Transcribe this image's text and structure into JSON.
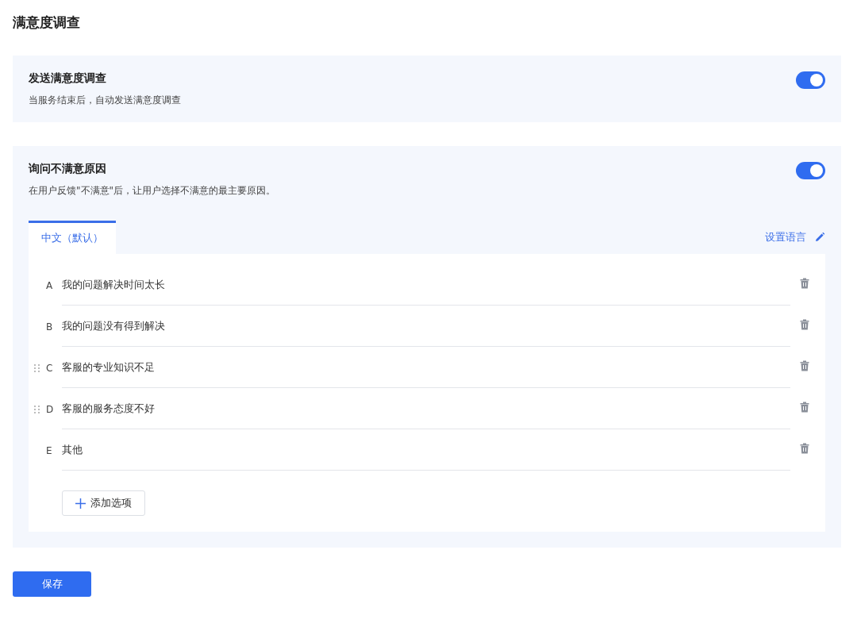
{
  "page_title": "满意度调查",
  "settings": [
    {
      "title": "发送满意度调查",
      "description": "当服务结束后，自动发送满意度调查",
      "on": true
    },
    {
      "title": "询问不满意原因",
      "description": "在用户反馈\"不满意\"后，让用户选择不满意的最主要原因。",
      "on": true
    }
  ],
  "language_tabs": [
    {
      "label": "中文（默认）",
      "selected": true
    }
  ],
  "set_language_link": "设置语言",
  "options": [
    {
      "letter": "A",
      "text": "我的问题解决时间太长",
      "draggable": false
    },
    {
      "letter": "B",
      "text": "我的问题没有得到解决",
      "draggable": false
    },
    {
      "letter": "C",
      "text": "客服的专业知识不足",
      "draggable": true
    },
    {
      "letter": "D",
      "text": "客服的服务态度不好",
      "draggable": true
    },
    {
      "letter": "E",
      "text": "其他",
      "draggable": false
    }
  ],
  "add_option_button": "添加选项",
  "save_button": "保存"
}
